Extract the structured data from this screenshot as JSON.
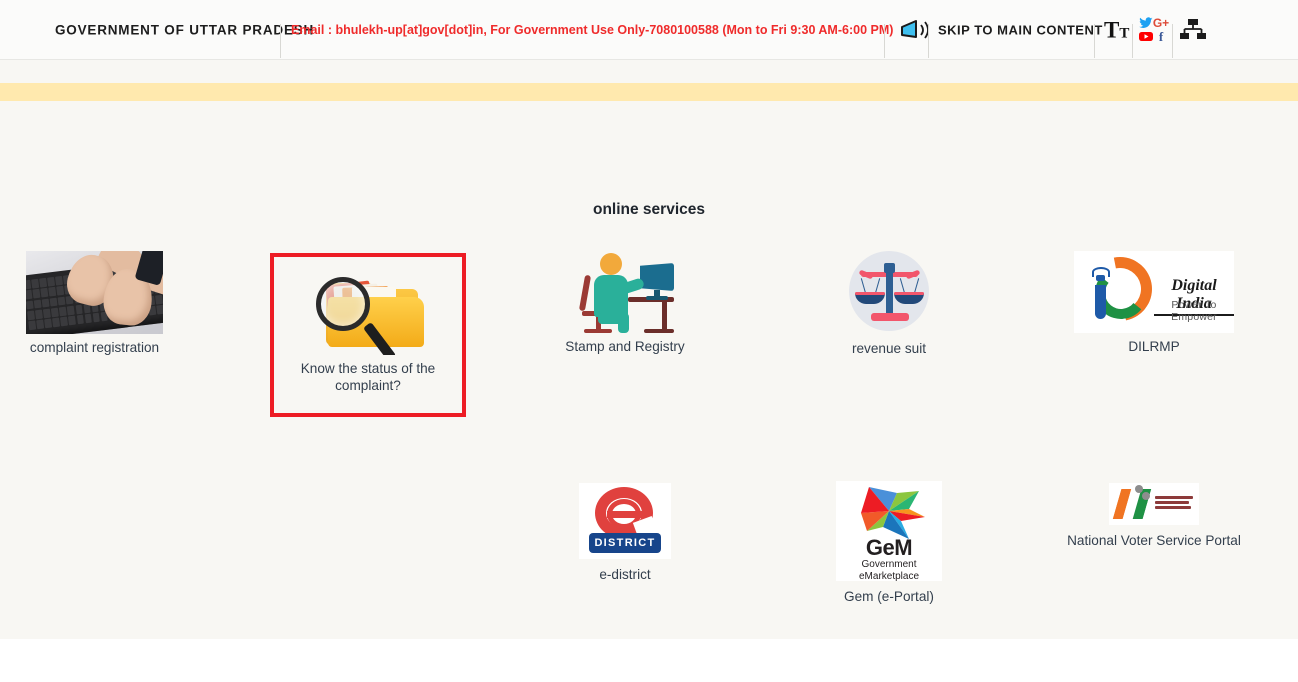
{
  "topbar": {
    "government": "GOVERNMENT OF UTTAR PRADESH",
    "email_notice": "Email : bhulekh-up[at]gov[dot]in, For Government Use Only-7080100588 (Mon to Fri 9:30 AM-6:00 PM)",
    "skip_link": "SKIP TO MAIN CONTENT",
    "text_size_big": "T",
    "text_size_small": "T",
    "audio_icon": "speaker-audio-icon",
    "social": {
      "twitter": "twitter-icon",
      "google_plus": "G+",
      "youtube": "youtube-icon",
      "facebook": "f"
    },
    "sitemap_icon": "sitemap-icon",
    "accent_red": "#ef2b2b"
  },
  "strip": {
    "color": "#ffe9ae"
  },
  "main": {
    "section_title": "online services",
    "background": "#f8f7f3",
    "highlight_color": "#ed1c24",
    "row1": [
      {
        "id": "complaint-registration",
        "label": "complaint registration",
        "icon": "keyboard-typing-photo",
        "selected": false
      },
      {
        "id": "complaint-status",
        "label": "Know the status of the complaint?",
        "icon": "folder-magnifier-icon",
        "selected": true
      },
      {
        "id": "stamp-and-registry",
        "label": "Stamp and Registry",
        "icon": "person-at-computer-icon",
        "selected": false
      },
      {
        "id": "revenue-suit",
        "label": "revenue suit",
        "icon": "scales-of-justice-icon",
        "selected": false
      },
      {
        "id": "dilrmp",
        "label": "DILRMP",
        "icon": "digital-india-logo",
        "selected": false
      }
    ],
    "row2": [
      {
        "id": "e-district",
        "label": "e-district",
        "icon": "e-district-logo",
        "selected": false
      },
      {
        "id": "gem-e-portal",
        "label": "Gem (e-Portal)",
        "icon": "gem-logo",
        "selected": false
      },
      {
        "id": "national-voter-service-portal",
        "label": "National Voter Service Portal",
        "icon": "election-commission-logo",
        "selected": false
      }
    ],
    "logos": {
      "digital_india_title": "Digital India",
      "digital_india_subtitle": "Power To Empower",
      "e_district_banner": "DISTRICT",
      "gem_name": "GeM",
      "gem_sub_line1": "Government",
      "gem_sub_line2": "eMarketplace"
    }
  }
}
